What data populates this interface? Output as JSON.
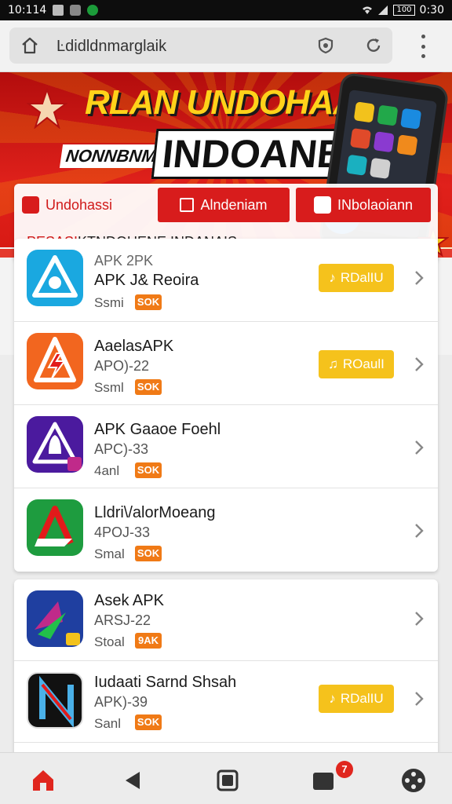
{
  "status_bar": {
    "time": "10:114",
    "clock_right": "0:30",
    "battery": "100"
  },
  "browser": {
    "url": "Ŀdidldnmarglaik"
  },
  "hero": {
    "title_line1": "RLAN UNDOHAAI",
    "title_line2_small": "NONNBNMAN",
    "title_line2": "INDOANBAA"
  },
  "tabs": [
    {
      "label": "Undohassi",
      "active": false
    },
    {
      "label": "Alndeniam",
      "active": true
    },
    {
      "label": "INbolaoiann",
      "active": true
    }
  ],
  "section": {
    "accent": "PESASI",
    "title": "KTNDOUENE INDANAIS"
  },
  "apps": [
    {
      "name_top": "APK 2PK",
      "name": "APK J& Reoira",
      "version": "",
      "size_label": "Ssmi",
      "size_badge": "SOK",
      "button": "RDalIU",
      "icon": "blue-triangle-app-icon",
      "icon_color": "#1aa8e0"
    },
    {
      "name": "AaelasAPK",
      "version": "APO)-22",
      "size_label": "Ssml",
      "size_badge": "SOK",
      "button": "ROaulI",
      "icon": "orange-lightning-app-icon",
      "icon_color": "#f2661f"
    },
    {
      "name": "APK Gaaoe Foehl",
      "version": "APC)-33",
      "size_label": "4anl",
      "size_badge": "SOK",
      "button": "",
      "icon": "purple-bell-app-icon",
      "icon_color": "#4b1a9e"
    },
    {
      "name": "Lldri\\/alorMoeang",
      "version": "4POJ-33",
      "size_label": "Smal",
      "size_badge": "SOK",
      "button": "",
      "icon": "green-a-app-icon",
      "icon_color": "#1e9c3f"
    },
    {
      "name": "Asek APK",
      "version": "ARSJ-22",
      "size_label": "Stoal",
      "size_badge": "9AK",
      "button": "",
      "icon": "colorful-swoosh-app-icon",
      "icon_color": "#1f3fa0"
    },
    {
      "name": "Iudaati Sarnd Shsah",
      "version": "APK)-39",
      "size_label": "Sanl",
      "size_badge": "SOK",
      "button": "RDalIU",
      "icon": "black-n-app-icon",
      "icon_color": "#111111"
    }
  ],
  "bottom_nav": {
    "badge_count": "7"
  }
}
